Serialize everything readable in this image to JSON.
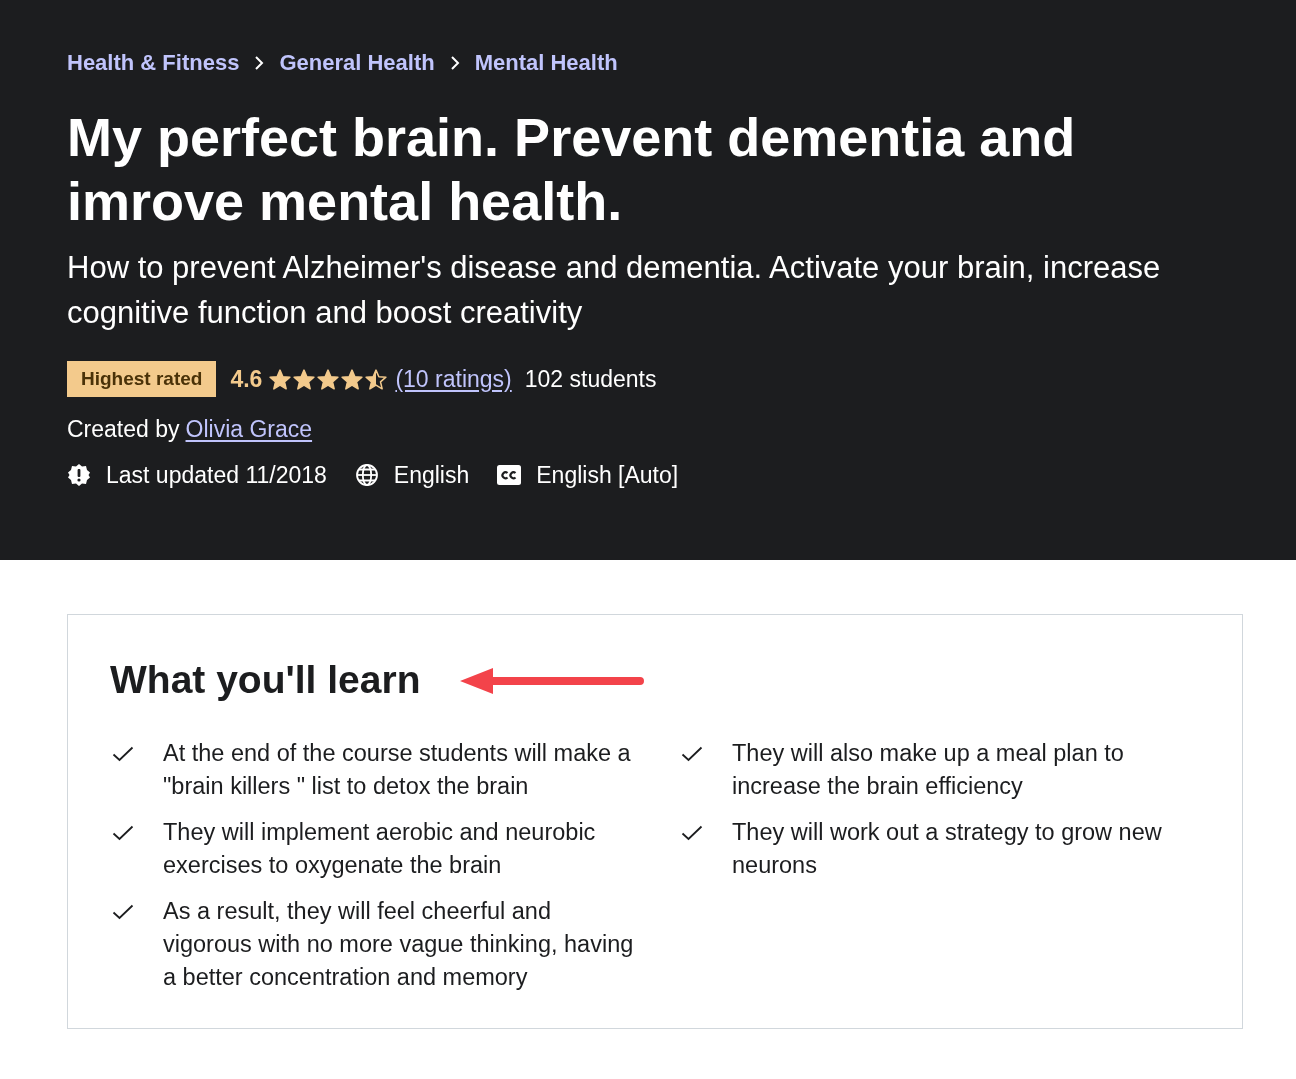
{
  "breadcrumbs": [
    {
      "label": "Health & Fitness"
    },
    {
      "label": "General Health"
    },
    {
      "label": "Mental Health"
    }
  ],
  "course": {
    "title": "My perfect brain. Prevent dementia and imrove mental health.",
    "subtitle": "How to prevent Alzheimer's disease and dementia. Activate your brain, increase cognitive function and boost creativity",
    "badge": "Highest rated",
    "rating": "4.6",
    "stars": 4.5,
    "ratings_link": "(10 ratings)",
    "students": "102 students",
    "created_by_label": "Created by",
    "instructor": "Olivia Grace",
    "meta": [
      {
        "kind": "updated",
        "text": "Last updated 11/2018"
      },
      {
        "kind": "language",
        "text": "English"
      },
      {
        "kind": "captions",
        "text": "English [Auto]"
      }
    ]
  },
  "learn": {
    "heading": "What you'll learn",
    "objectives": [
      "At the end of the course students will make a \"brain killers \" list to detox the brain",
      "They will also make up a meal plan to increase the brain efficiency",
      "They will implement aerobic and neurobic exercises to oxygenate the brain",
      "They will work out a strategy to grow new neurons",
      "As a result, they will feel cheerful and vigorous with no more vague thinking, having a better concentration and memory"
    ]
  }
}
